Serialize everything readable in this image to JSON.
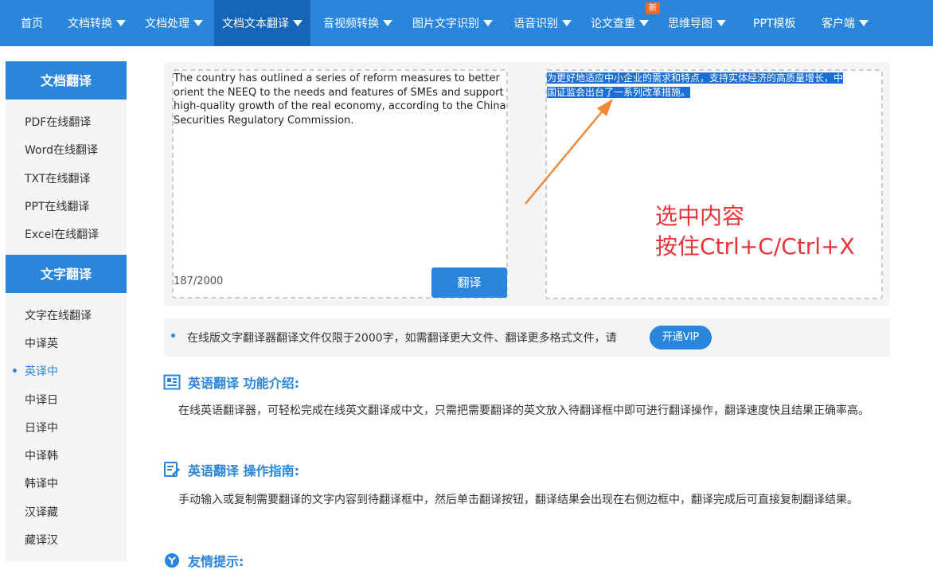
{
  "nav": {
    "items": [
      {
        "label": "首页",
        "dropdown": false
      },
      {
        "label": "文档转换",
        "dropdown": true
      },
      {
        "label": "文档处理",
        "dropdown": true
      },
      {
        "label": "文档文本翻译",
        "dropdown": true,
        "active": true
      },
      {
        "label": "音视频转换",
        "dropdown": true
      },
      {
        "label": "图片文字识别",
        "dropdown": true
      },
      {
        "label": "语音识别",
        "dropdown": true
      },
      {
        "label": "论文查重",
        "dropdown": true,
        "badge": "新"
      },
      {
        "label": "思维导图",
        "dropdown": true
      },
      {
        "label": "PPT模板",
        "dropdown": false
      },
      {
        "label": "客户端",
        "dropdown": true
      }
    ]
  },
  "sidebar": {
    "doc_head": "文档翻译",
    "doc_items": [
      "PDF在线翻译",
      "Word在线翻译",
      "TXT在线翻译",
      "PPT在线翻译",
      "Excel在线翻译"
    ],
    "text_head": "文字翻译",
    "text_items": [
      "文字在线翻译",
      "中译英",
      "英译中",
      "中译日",
      "日译中",
      "中译韩",
      "韩译中",
      "汉译藏",
      "藏译汉"
    ],
    "active_item": "英译中"
  },
  "translator": {
    "source_text": "The country has outlined a series of reform measures to better orient the NEEQ to the needs and features of SMEs and support high-quality growth of the real economy, according to the China Securities Regulatory Commission.",
    "char_count": "187/2000",
    "translate_button": "翻译",
    "result_text_line1": "为更好地适应中小企业的需求和特点，支持实体经济的高质量增长，中",
    "result_text_line2": "国证监会出台了一系列改革措施。",
    "annotation_line1": "选中内容",
    "annotation_line2": "按住Ctrl+C/Ctrl+X",
    "highlight_color": "#1a6fd6",
    "annotation_color": "#e8333a",
    "arrow_color": "#f0883a"
  },
  "notice": {
    "text": "在线版文字翻译器翻译文件仅限于2000字，如需翻译更大文件、翻译更多格式文件，请",
    "vip_button": "开通VIP"
  },
  "sections": {
    "intro_title": "英语翻译 功能介绍:",
    "intro_body": "在线英语翻译器，可轻松完成在线英文翻译成中文，只需把需要翻译的英文放入待翻译框中即可进行翻译操作，翻译速度快且结果正确率高。",
    "guide_title": "英语翻译 操作指南:",
    "guide_body": "手动输入或复制需要翻译的文字内容到待翻译框中，然后单击翻译按钮，翻译结果会出现在右侧边框中，翻译完成后可直接复制翻译结果。",
    "tips_title": "友情提示:"
  },
  "colors": {
    "primary": "#2a86dd",
    "nav_active": "#1565b8",
    "badge": "#f26a2b"
  }
}
